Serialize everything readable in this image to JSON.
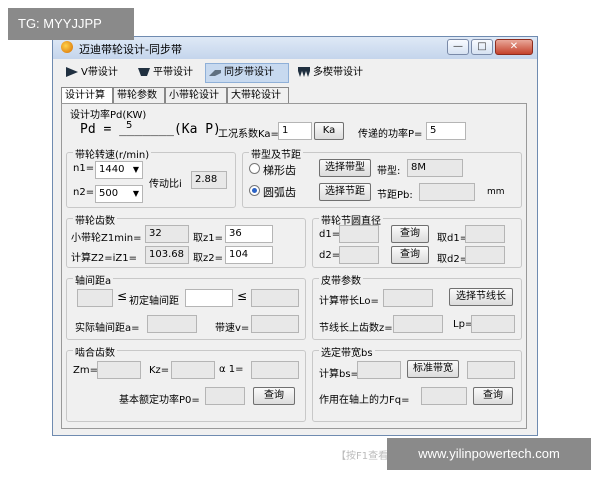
{
  "watermarks": {
    "tg": "TG: MYYJJPP",
    "url": "www.yilinpowertech.com"
  },
  "window": {
    "title": "迈迪带轮设计-同步带",
    "btn_min": "—",
    "btn_max": "□",
    "btn_close": "✕"
  },
  "toolbar": {
    "v_belt": "V带设计",
    "flat_belt": "平带设计",
    "sync_belt": "同步带设计",
    "multi_wedge": "多楔带设计"
  },
  "tabs": [
    "设计计算",
    "带轮参数",
    "小带轮设计",
    "大带轮设计"
  ],
  "design_power": {
    "heading": "设计功率Pd(KW)",
    "pd_label": "Pd = _______(Ka P)",
    "pd_value": "5",
    "ka_label": "工况系数Ka=",
    "ka_value": "1",
    "ka_button": "Ka",
    "power_label": "传递的功率P=",
    "power_value": "5"
  },
  "speed": {
    "title": "带轮转速(r/min)",
    "n1_label": "n1=",
    "n1_value": "1440",
    "n2_label": "n2=",
    "n2_value": "500",
    "ratio_label": "传动比i",
    "ratio_value": "2.88"
  },
  "belt_type": {
    "title": "带型及节距",
    "trap_label": "梯形齿",
    "arc_label": "圆弧齿",
    "select_type_btn": "选择带型",
    "type_label": "带型:",
    "type_value": "8M",
    "select_pitch_btn": "选择节距",
    "pitch_label": "节距Pb:",
    "pitch_value": "",
    "pitch_unit": "mm"
  },
  "teeth": {
    "title": "带轮齿数",
    "z1min_label": "小带轮Z1min=",
    "z1min_value": "32",
    "z1_label": "取z1=",
    "z1_value": "36",
    "z2_calc_label": "计算Z2=iZ1=",
    "z2_calc_value": "103.68",
    "z2_label": "取z2=",
    "z2_value": "104"
  },
  "pitch_diameter": {
    "title": "带轮节圆直径",
    "d1_label": "d1=",
    "d2_label": "d2=",
    "query1": "查询",
    "query2": "查询",
    "take_d1": "取d1=",
    "take_d2": "取d2="
  },
  "center_distance": {
    "title": "轴间距a",
    "lt1": "≤",
    "initial_label": "初定轴间距",
    "lt2": "≤",
    "actual_label": "实际轴间距a=",
    "speed_label": "带速v="
  },
  "belt_params": {
    "title": "皮带参数",
    "lo_label": "计算带长Lo=",
    "select_length_btn": "选择节线长",
    "teeth_label": "节线长上齿数z=",
    "lp_label": "Lp="
  },
  "mesh": {
    "title": "啮合齿数",
    "zm_label": "Zm=",
    "kz_label": "Kz=",
    "alpha_label": "α 1=",
    "rated_label": "基本额定功率P0=",
    "query_btn": "查询"
  },
  "belt_width": {
    "title": "选定带宽bs",
    "bs_label": "计算bs=",
    "std_btn": "标准带宽",
    "force_label": "作用在轴上的力Fq=",
    "query_btn": "查询"
  },
  "hint": "【按F1查看帮"
}
